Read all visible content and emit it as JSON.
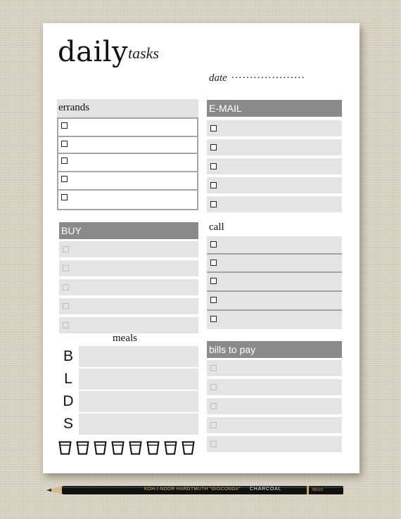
{
  "header": {
    "title": "daily",
    "subtitle": "tasks",
    "date_label": "date",
    "date_dots": "...................."
  },
  "errands": {
    "label": "errands",
    "row_count": 5
  },
  "email": {
    "label": "E-MAIL",
    "row_count": 5
  },
  "buy": {
    "label": "BUY",
    "row_count": 5
  },
  "call": {
    "label": "call",
    "row_count": 5
  },
  "bills": {
    "label": "bills to pay",
    "row_count": 5
  },
  "meals": {
    "label": "meals",
    "letters": [
      "B",
      "L",
      "D",
      "S"
    ]
  },
  "water": {
    "glass_count": 8,
    "icon": "water-glass-icon"
  },
  "pencil": {
    "brand_text": "KOH-I-NOOR HARDTMUTH \"GIOCONDA\"",
    "type_text": "CHARCOAL",
    "code_text": "8810/2"
  },
  "colors": {
    "background": "#d9d3c4",
    "paper": "#ffffff",
    "row_fill": "#e4e4e4",
    "header_fill": "#8a8a8a"
  }
}
